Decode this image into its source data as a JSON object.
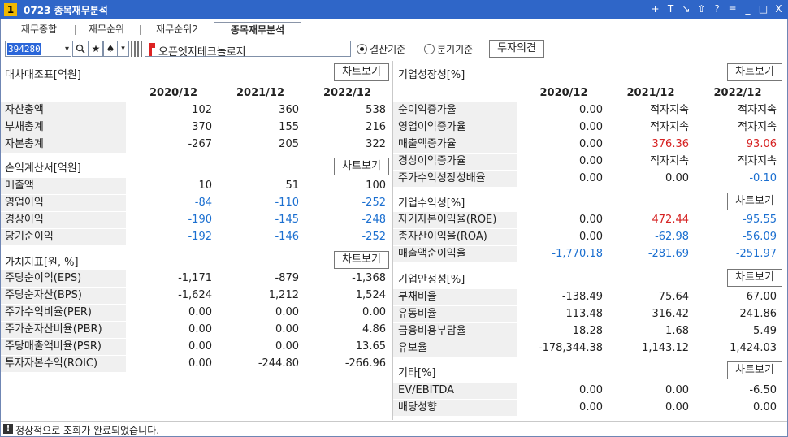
{
  "window": {
    "number": "1",
    "title": "0723 종목재무분석",
    "controls": [
      "+",
      "T",
      "↘",
      "⇧",
      "?",
      "≡",
      "_",
      "□",
      "X"
    ]
  },
  "tabs": [
    {
      "label": "재무종합",
      "active": false
    },
    {
      "label": "재무순위",
      "active": false
    },
    {
      "label": "재무순위2",
      "active": false
    },
    {
      "label": "종목재무분석",
      "active": true
    }
  ],
  "toolbar": {
    "code": "394280",
    "search_icon": "magnifier",
    "star_icon": "★",
    "spade_icon": "♠",
    "dropdown_icon": "▾",
    "stock_name": "오픈엣지테크놀로지",
    "radio_settlement": "결산기준",
    "radio_quarter": "분기기준",
    "invest_button": "투자의견"
  },
  "left": {
    "years": [
      "2020/12",
      "2021/12",
      "2022/12"
    ],
    "chart_button": "차트보기",
    "balance": {
      "title": "대차대조표[억원]",
      "rows": [
        {
          "label": "자산총액",
          "values": [
            "102",
            "360",
            "538"
          ]
        },
        {
          "label": "부채총계",
          "values": [
            "370",
            "155",
            "216"
          ]
        },
        {
          "label": "자본총계",
          "values": [
            "-267",
            "205",
            "322"
          ]
        }
      ]
    },
    "income": {
      "title": "손익계산서[억원]",
      "rows": [
        {
          "label": "매출액",
          "values": [
            "10",
            "51",
            "100"
          ]
        },
        {
          "label": "영업이익",
          "values": [
            "-84",
            "-110",
            "-252"
          ]
        },
        {
          "label": "경상이익",
          "values": [
            "-190",
            "-145",
            "-248"
          ]
        },
        {
          "label": "당기순이익",
          "values": [
            "-192",
            "-146",
            "-252"
          ]
        }
      ]
    },
    "value": {
      "title": "가치지표[원, %]",
      "rows": [
        {
          "label": "주당순이익(EPS)",
          "values": [
            "-1,171",
            "-879",
            "-1,368"
          ]
        },
        {
          "label": "주당순자산(BPS)",
          "values": [
            "-1,624",
            "1,212",
            "1,524"
          ]
        },
        {
          "label": "주가수익비율(PER)",
          "values": [
            "0.00",
            "0.00",
            "0.00"
          ]
        },
        {
          "label": "주가순자산비율(PBR)",
          "values": [
            "0.00",
            "0.00",
            "4.86"
          ]
        },
        {
          "label": "주당매출액비율(PSR)",
          "values": [
            "0.00",
            "0.00",
            "13.65"
          ]
        },
        {
          "label": "투자자본수익(ROIC)",
          "values": [
            "0.00",
            "-244.80",
            "-266.96"
          ]
        }
      ]
    }
  },
  "right": {
    "years": [
      "2020/12",
      "2021/12",
      "2022/12"
    ],
    "chart_button": "차트보기",
    "growth": {
      "title": "기업성장성[%]",
      "rows": [
        {
          "label": "순이익증가율",
          "values": [
            "0.00",
            "적자지속",
            "적자지속"
          ]
        },
        {
          "label": "영업이익증가율",
          "values": [
            "0.00",
            "적자지속",
            "적자지속"
          ]
        },
        {
          "label": "매출액증가율",
          "values": [
            "0.00",
            "376.36",
            "93.06"
          ]
        },
        {
          "label": "경상이익증가율",
          "values": [
            "0.00",
            "적자지속",
            "적자지속"
          ]
        },
        {
          "label": "주가수익성장성배율",
          "values": [
            "0.00",
            "0.00",
            "-0.10"
          ]
        }
      ]
    },
    "profit": {
      "title": "기업수익성[%]",
      "rows": [
        {
          "label": "자기자본이익율(ROE)",
          "values": [
            "0.00",
            "472.44",
            "-95.55"
          ]
        },
        {
          "label": "총자산이익율(ROA)",
          "values": [
            "0.00",
            "-62.98",
            "-56.09"
          ]
        },
        {
          "label": "매출액순이익율",
          "values": [
            "-1,770.18",
            "-281.69",
            "-251.97"
          ]
        }
      ]
    },
    "stability": {
      "title": "기업안정성[%]",
      "rows": [
        {
          "label": "부채비율",
          "values": [
            "-138.49",
            "75.64",
            "67.00"
          ]
        },
        {
          "label": "유동비율",
          "values": [
            "113.48",
            "316.42",
            "241.86"
          ]
        },
        {
          "label": "금융비용부담율",
          "values": [
            "18.28",
            "1.68",
            "5.49"
          ]
        },
        {
          "label": "유보율",
          "values": [
            "-178,344.38",
            "1,143.12",
            "1,424.03"
          ]
        }
      ]
    },
    "etc": {
      "title": "기타[%]",
      "rows": [
        {
          "label": "EV/EBITDA",
          "values": [
            "0.00",
            "0.00",
            "-6.50"
          ]
        },
        {
          "label": "배당성향",
          "values": [
            "0.00",
            "0.00",
            "0.00"
          ]
        }
      ]
    }
  },
  "status": {
    "icon": "!",
    "message": "정상적으로 조회가 완료되었습니다."
  },
  "colors": {
    "titlebar": "#2f66c8",
    "negative": "#1b6fd0",
    "positive_highlight": "#d62222",
    "label_bg": "#f0f0f0"
  }
}
